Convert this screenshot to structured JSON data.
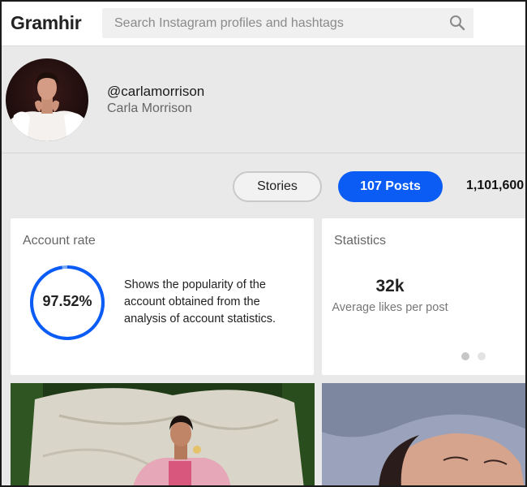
{
  "header": {
    "logo": "Gramhir",
    "search_placeholder": "Search Instagram profiles and hashtags"
  },
  "profile": {
    "username": "@carlamorrison",
    "full_name": "Carla Morrison"
  },
  "tabs": {
    "stories": "Stories",
    "posts": "107 Posts",
    "followers": "1,101,600"
  },
  "account_rate": {
    "title": "Account rate",
    "value": "97.52%",
    "fraction": 0.9752,
    "description": "Shows the popularity of the account obtained from the analysis of account statistics."
  },
  "statistics": {
    "title": "Statistics",
    "value": "32k",
    "label": "Average likes per post",
    "carousel_pages": 2,
    "active_page": 1
  },
  "colors": {
    "accent": "#0a5cf5",
    "gauge_track": "#7aa7f0"
  }
}
